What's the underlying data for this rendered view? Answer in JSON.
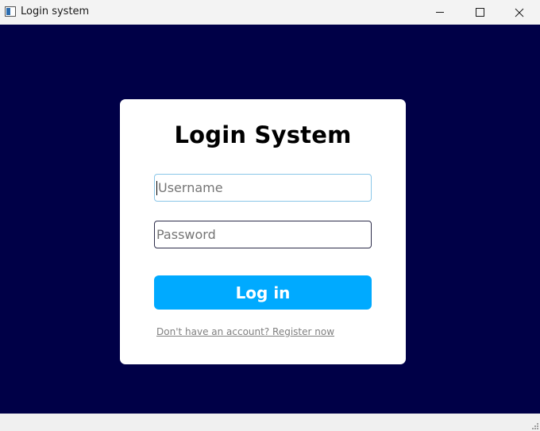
{
  "window": {
    "title": "Login system",
    "icon": "app-window-icon"
  },
  "card": {
    "title": "Login System",
    "username": {
      "placeholder": "Username",
      "value": ""
    },
    "password": {
      "placeholder": "Password",
      "value": ""
    },
    "login_label": "Log in",
    "register_label": "Don't have an account? Register now"
  },
  "colors": {
    "background": "#000047",
    "card": "#ffffff",
    "accent": "#00aaff",
    "focus_border": "#89c6e8",
    "link": "#808080"
  }
}
